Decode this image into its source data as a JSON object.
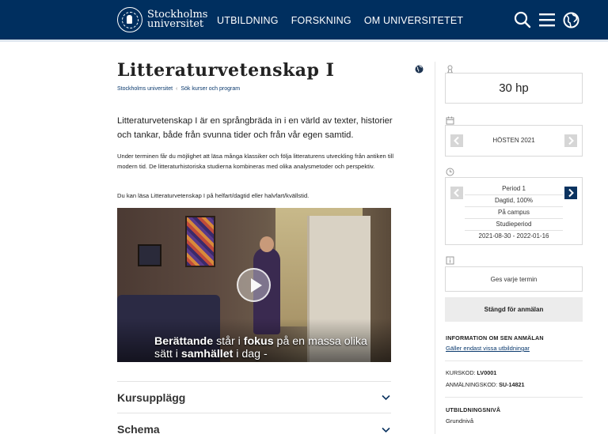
{
  "header": {
    "logo_line1": "Stockholms",
    "logo_line2": "universitet",
    "nav": [
      "UTBILDNING",
      "FORSKNING",
      "OM UNIVERSITETET"
    ],
    "icons": [
      "search-icon",
      "menu-icon",
      "globe-icon"
    ],
    "bg_color": "#002f5f"
  },
  "page": {
    "title": "Litteraturvetenskap I",
    "breadcrumb": [
      "Stockholms universitet",
      "Sök kurser och program"
    ],
    "lead": "Litteraturvetenskap I är en språngbräda in i en värld av texter, historier och tankar, både från svunna tider och från vår egen samtid.",
    "para1": "Under terminen får du möjlighet att läsa många klassiker och följa litteraturens utveckling från antiken till modern tid. De litteraturhistoriska studierna kombineras med olika analysmetoder och perspektiv.",
    "para2": "Du kan läsa Litteraturvetenskap I på helfart/dagtid eller halvfart/kvällstid.",
    "video_caption_b1": "Berättande",
    "video_caption_t1": " står i ",
    "video_caption_b2": "fokus",
    "video_caption_t2": " på en massa olika",
    "video_caption_t3": "sätt i ",
    "video_caption_b3": "samhället",
    "video_caption_t4": " i dag -",
    "accordions": [
      "Kursupplägg",
      "Schema"
    ]
  },
  "sidebar": {
    "credits": "30 hp",
    "term": "HÖSTEN 2021",
    "period": [
      "Period 1",
      "Dagtid, 100%",
      "På campus",
      "Studieperiod",
      "2021-08-30 - 2022-01-16"
    ],
    "frequency": "Ges varje termin",
    "status_button": "Stängd för anmälan",
    "late_heading": "INFORMATION OM SEN ANMÄLAN",
    "late_link": "Gäller endast vissa utbildningar",
    "course_code_label": "KURSKOD: ",
    "course_code": "LV0001",
    "app_code_label": "ANMÄLNINGSKOD: ",
    "app_code": "SU-14821",
    "level_heading": "UTBILDNINGSNIVÅ",
    "level": "Grundnivå"
  }
}
